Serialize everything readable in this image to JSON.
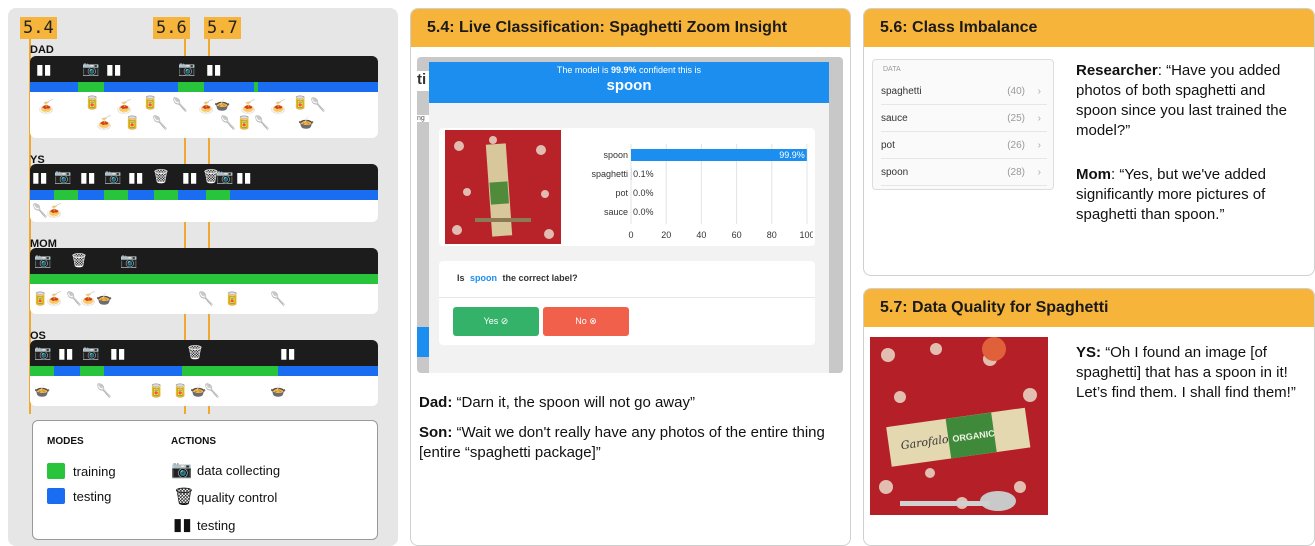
{
  "markers": [
    "5.4",
    "5.6",
    "5.7"
  ],
  "participants": [
    {
      "name": "DAD"
    },
    {
      "name": "YS"
    },
    {
      "name": "MOM"
    },
    {
      "name": "OS"
    }
  ],
  "legend": {
    "modes_head": "MODES",
    "actions_head": "ACTIONS",
    "training": "training",
    "testing": "testing",
    "data_collecting": "data collecting",
    "quality_control": "quality control",
    "testing_action": "testing"
  },
  "colors": {
    "training": "#27c43c",
    "testing": "#1a6cf0",
    "accent": "#f7b43a"
  },
  "panel_54": {
    "title": "5.4: Live Classification: Spaghetti Zoom Insight",
    "app": {
      "confidence_prefix": "The model is",
      "confidence_value": "99.9%",
      "confidence_suffix": "confident this is",
      "prediction": "spoon",
      "question_prefix": "Is",
      "question_label": "spoon",
      "question_suffix": "the correct label?",
      "yes": "Yes ⊘",
      "no": "No ⊗",
      "side_letter": "ti",
      "side_small": "ng"
    },
    "quote_dad_speaker": "Dad:",
    "quote_dad": "“Darn it, the spoon will not go away”",
    "quote_son_speaker": "Son:",
    "quote_son": "“Wait we don't really have any photos of the entire thing [entire “spaghetti package]”"
  },
  "chart_data": {
    "type": "bar",
    "orientation": "horizontal",
    "categories": [
      "spoon",
      "spaghetti",
      "pot",
      "sauce"
    ],
    "values": [
      99.9,
      0.1,
      0.0,
      0.0
    ],
    "value_labels": [
      "99.9%",
      "0.1%",
      "0.0%",
      "0.0%"
    ],
    "xlim": [
      0,
      100
    ],
    "xticks": [
      "0",
      "20",
      "40",
      "60",
      "80",
      "100"
    ],
    "bar_color": "#1b8ef0"
  },
  "panel_56": {
    "title": "5.6: Class Imbalance",
    "data_header": "DATA",
    "rows": [
      {
        "label": "spaghetti",
        "count": "(40)"
      },
      {
        "label": "sauce",
        "count": "(25)"
      },
      {
        "label": "pot",
        "count": "(26)"
      },
      {
        "label": "spoon",
        "count": "(28)"
      }
    ],
    "researcher_speaker": "Researcher",
    "researcher_quote": ": “Have you added photos of both spaghetti and spoon since you last trained the model?”",
    "mom_speaker": "Mom",
    "mom_quote": ": “Yes, but we've added significantly more pictures of spaghetti than spoon.”"
  },
  "panel_57": {
    "title": "5.7: Data Quality for Spaghetti",
    "ys_speaker": "YS:",
    "ys_quote": "“Oh I found an image [of spaghetti] that has a spoon in it!  Let’s find them.  I shall find them!”",
    "package_text_1": "Garofalo",
    "package_text_2": "ORGANIC"
  }
}
